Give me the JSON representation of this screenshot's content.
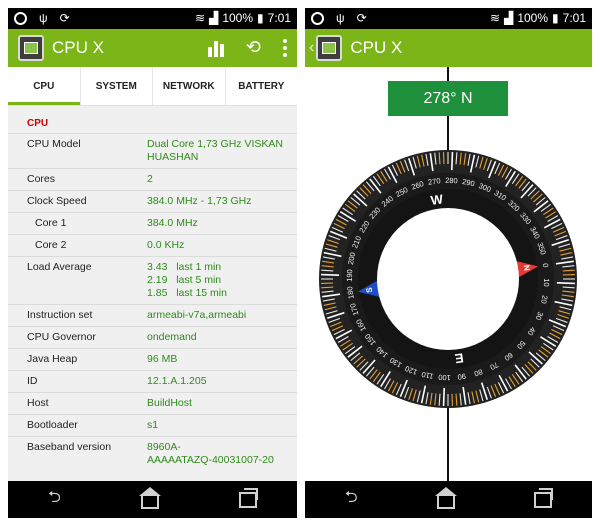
{
  "status": {
    "battery_percent": "100%",
    "time": "7:01"
  },
  "app": {
    "title": "CPU X"
  },
  "tabs": [
    "CPU",
    "SYSTEM",
    "NETWORK",
    "BATTERY"
  ],
  "cpu": {
    "section_title": "CPU",
    "rows": [
      {
        "label": "CPU Model",
        "value": "Dual Core 1,73 GHz VISKAN\nHUASHAN"
      },
      {
        "label": "Cores",
        "value": "2"
      },
      {
        "label": "Clock Speed",
        "value": "384.0 MHz - 1,73 GHz"
      },
      {
        "label": "Core 1",
        "value": "384.0 MHz"
      },
      {
        "label": "Core 2",
        "value": "0.0 KHz"
      },
      {
        "label": "Load Average",
        "value": "3.43   last 1 min\n2.19   last 5 min\n1.85   last 15 min"
      },
      {
        "label": "Instruction set",
        "value": "armeabi-v7a,armeabi"
      },
      {
        "label": "CPU Governor",
        "value": "ondemand"
      },
      {
        "label": "Java Heap",
        "value": "96 MB"
      },
      {
        "label": "ID",
        "value": "12.1.A.1.205"
      },
      {
        "label": "Host",
        "value": "BuildHost"
      },
      {
        "label": "Bootloader",
        "value": "s1"
      },
      {
        "label": "Baseband version",
        "value": "8960A-\nAAAAATAZQ-40031007-20"
      }
    ]
  },
  "compass": {
    "heading_text": "278° N",
    "heading_deg": 278,
    "cardinals": [
      "N",
      "E",
      "S",
      "W"
    ],
    "degree_labels": [
      "0",
      "10",
      "20",
      "30",
      "40",
      "50",
      "60",
      "70",
      "80",
      "90",
      "100",
      "110",
      "120",
      "130",
      "140",
      "150",
      "160",
      "170",
      "180",
      "190",
      "200",
      "210",
      "220",
      "230",
      "240",
      "250",
      "260",
      "270",
      "280",
      "290",
      "300",
      "310",
      "320",
      "330",
      "340",
      "350"
    ],
    "colors": {
      "accent": "#7cb518",
      "heading_bg": "#1e8f3a",
      "north": "#e53935",
      "south": "#1e4fc7"
    }
  }
}
